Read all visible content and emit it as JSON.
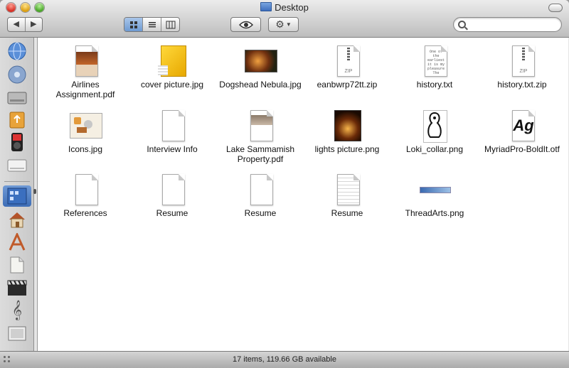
{
  "window": {
    "title": "Desktop"
  },
  "toolbar": {
    "back_icon": "back-arrow-icon",
    "forward_icon": "forward-arrow-icon",
    "view_modes": [
      "icon-view",
      "list-view",
      "column-view"
    ],
    "active_view": "icon-view",
    "quick_look_icon": "eye-icon",
    "action_icon": "gear-icon",
    "search": {
      "value": "",
      "placeholder": ""
    }
  },
  "sidebar": {
    "items": [
      {
        "icon": "network-globe-icon"
      },
      {
        "icon": "disk-icon"
      },
      {
        "icon": "hard-drive-icon"
      },
      {
        "icon": "usb-drive-icon"
      },
      {
        "icon": "ipod-icon"
      },
      {
        "icon": "external-drive-icon"
      },
      {
        "icon": "desktop-icon",
        "selected": true
      },
      {
        "icon": "home-icon"
      },
      {
        "icon": "applications-icon"
      },
      {
        "icon": "documents-icon"
      },
      {
        "icon": "movies-icon"
      },
      {
        "icon": "music-icon"
      },
      {
        "icon": "pictures-icon"
      }
    ]
  },
  "files": [
    {
      "name": "Airlines Assignment.pdf",
      "icon": "pdf-icon"
    },
    {
      "name": "cover picture.jpg",
      "icon": "image-icon"
    },
    {
      "name": "Dogshead Nebula.jpg",
      "icon": "image-icon"
    },
    {
      "name": "eanbwrp72tt.zip",
      "icon": "zip-icon"
    },
    {
      "name": "history.txt",
      "icon": "text-file-icon"
    },
    {
      "name": "history.txt.zip",
      "icon": "zip-icon"
    },
    {
      "name": "Icons.jpg",
      "icon": "image-icon"
    },
    {
      "name": "Interview Info",
      "icon": "document-icon"
    },
    {
      "name": "Lake Sammamish Property.pdf",
      "icon": "pdf-icon"
    },
    {
      "name": "lights picture.png",
      "icon": "image-icon"
    },
    {
      "name": "Loki_collar.png",
      "icon": "image-icon"
    },
    {
      "name": "MyriadPro-BoldIt.otf",
      "icon": "font-icon"
    },
    {
      "name": "References",
      "icon": "document-icon"
    },
    {
      "name": "Resume",
      "icon": "document-icon"
    },
    {
      "name": "Resume",
      "icon": "document-icon"
    },
    {
      "name": "Resume",
      "icon": "document-icon"
    },
    {
      "name": "ThreadArts.png",
      "icon": "image-icon"
    }
  ],
  "status": {
    "text": "17 items, 119.66 GB available"
  },
  "text_preview": "One of the earliest it is my pleasure The reason why companies, but interest of those",
  "font_preview": "Ag",
  "zip_label": "ZIP"
}
